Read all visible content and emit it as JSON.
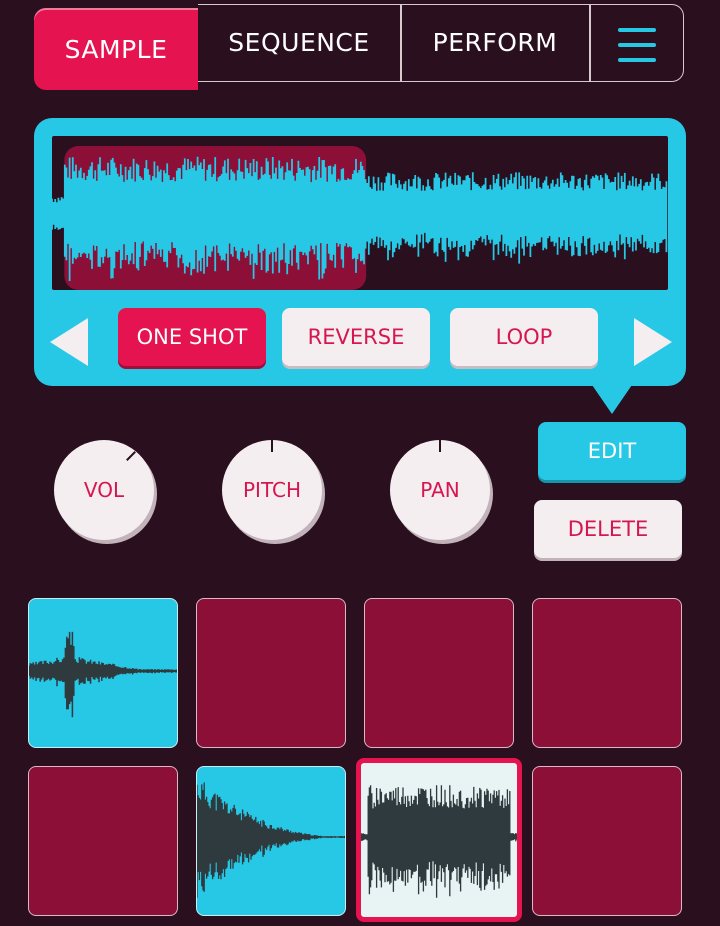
{
  "tabs": [
    {
      "label": "SAMPLE",
      "active": true
    },
    {
      "label": "SEQUENCE",
      "active": false
    },
    {
      "label": "PERFORM",
      "active": false
    }
  ],
  "menu_icon": "hamburger-menu-icon",
  "waveform": {
    "selection": {
      "start": 0.02,
      "end": 0.51
    }
  },
  "playback_modes": [
    {
      "label": "ONE SHOT",
      "active": true
    },
    {
      "label": "REVERSE",
      "active": false
    },
    {
      "label": "LOOP",
      "active": false
    }
  ],
  "nav_icons": {
    "prev": "triangle-left-icon",
    "next": "triangle-right-icon"
  },
  "knobs": [
    {
      "label": "VOL"
    },
    {
      "label": "PITCH"
    },
    {
      "label": "PAN"
    }
  ],
  "actions": {
    "edit_label": "EDIT",
    "delete_label": "DELETE"
  },
  "pads": [
    {
      "state": "loaded",
      "waveform": "transient"
    },
    {
      "state": "empty"
    },
    {
      "state": "empty"
    },
    {
      "state": "empty"
    },
    {
      "state": "empty"
    },
    {
      "state": "loaded",
      "waveform": "decay"
    },
    {
      "state": "selected",
      "waveform": "dense"
    },
    {
      "state": "empty"
    }
  ],
  "colors": {
    "background": "#2a0f1e",
    "accent_pink": "#e5134f",
    "accent_cyan": "#27c8e6",
    "pad_empty": "#8c0f38",
    "light": "#f4eef0"
  }
}
